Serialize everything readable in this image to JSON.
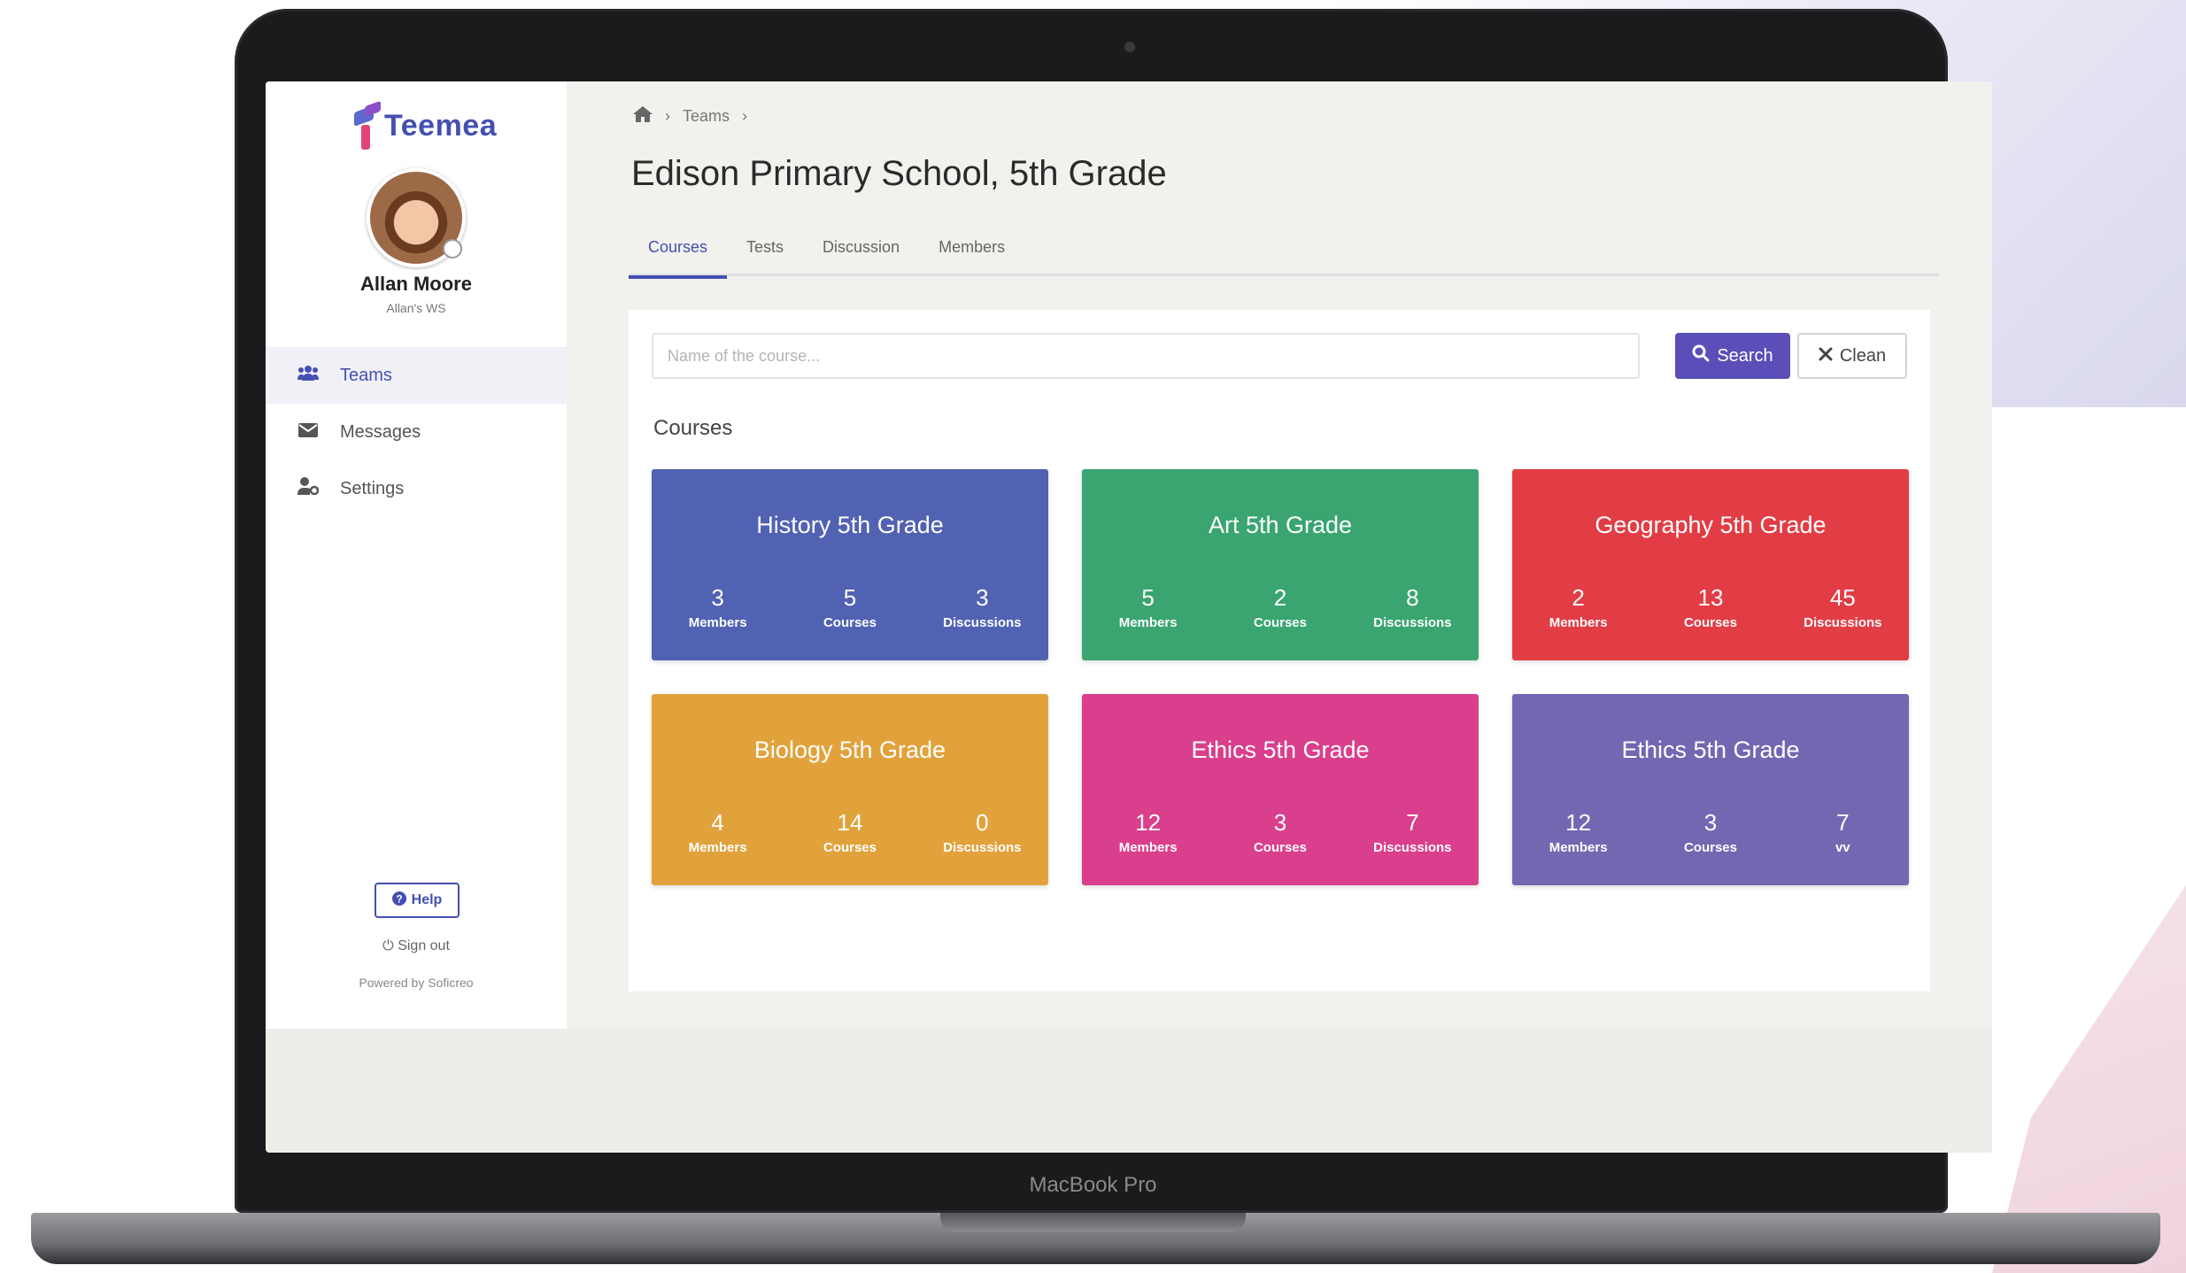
{
  "device": {
    "label": "MacBook Pro"
  },
  "sidebar": {
    "logo_text": "Teemea",
    "user_name": "Allan Moore",
    "user_workspace": "Allan's WS",
    "nav": [
      {
        "label": "Teams",
        "icon": "users-icon",
        "active": true
      },
      {
        "label": "Messages",
        "icon": "envelope-icon",
        "active": false
      },
      {
        "label": "Settings",
        "icon": "user-cog-icon",
        "active": false
      }
    ],
    "help_label": "Help",
    "signout_label": "Sign out",
    "powered_by": "Powered by Soficreo"
  },
  "breadcrumb": {
    "home_icon": "home-icon",
    "items": [
      "Teams"
    ]
  },
  "page_title": "Edison Primary School, 5th Grade",
  "tabs": [
    {
      "label": "Courses",
      "active": true
    },
    {
      "label": "Tests",
      "active": false
    },
    {
      "label": "Discussion",
      "active": false
    },
    {
      "label": "Members",
      "active": false
    }
  ],
  "search": {
    "placeholder": "Name of the course...",
    "value": "",
    "search_label": "Search",
    "clean_label": "Clean"
  },
  "section_title": "Courses",
  "courses": [
    {
      "title": "History 5th Grade",
      "color": "#5162b3",
      "stats": [
        {
          "value": "3",
          "label": "Members"
        },
        {
          "value": "5",
          "label": "Courses"
        },
        {
          "value": "3",
          "label": "Discussions"
        }
      ]
    },
    {
      "title": "Art 5th Grade",
      "color": "#3aa571",
      "stats": [
        {
          "value": "5",
          "label": "Members"
        },
        {
          "value": "2",
          "label": "Courses"
        },
        {
          "value": "8",
          "label": "Discussions"
        }
      ]
    },
    {
      "title": "Geography 5th Grade",
      "color": "#e23c45",
      "stats": [
        {
          "value": "2",
          "label": "Members"
        },
        {
          "value": "13",
          "label": "Courses"
        },
        {
          "value": "45",
          "label": "Discussions"
        }
      ]
    },
    {
      "title": "Biology 5th Grade",
      "color": "#e1a23c",
      "stats": [
        {
          "value": "4",
          "label": "Members"
        },
        {
          "value": "14",
          "label": "Courses"
        },
        {
          "value": "0",
          "label": "Discussions"
        }
      ]
    },
    {
      "title": "Ethics 5th Grade",
      "color": "#d93f8c",
      "stats": [
        {
          "value": "12",
          "label": "Members"
        },
        {
          "value": "3",
          "label": "Courses"
        },
        {
          "value": "7",
          "label": "Discussions"
        }
      ]
    },
    {
      "title": "Ethics 5th Grade",
      "color": "#7467b2",
      "stats": [
        {
          "value": "12",
          "label": "Members"
        },
        {
          "value": "3",
          "label": "Courses"
        },
        {
          "value": "7",
          "label": "vv"
        }
      ]
    }
  ]
}
